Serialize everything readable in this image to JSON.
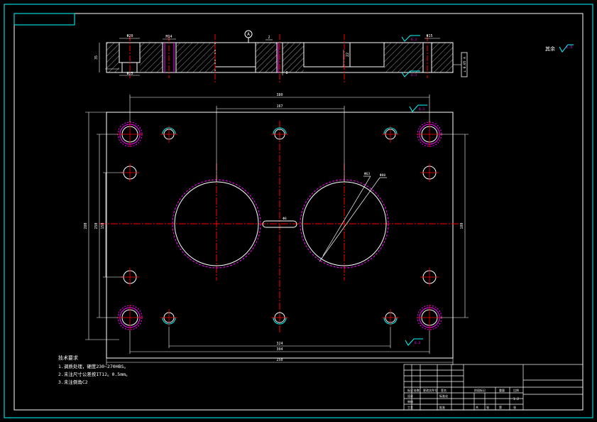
{
  "colors": {
    "background": "#000000",
    "border": "#00ffff",
    "outline": "#ffffff",
    "centerline": "#ff0000",
    "dimension": "#ffffff",
    "magenta": "#ff00ff",
    "finish": "#00ffff",
    "hatch": "#ffffff",
    "text": "#ffffff"
  },
  "section_view": {
    "label_A": "A",
    "dim_left_hole": "Φ20",
    "dim_left_counterbore": "Φ25",
    "dim_thread": "M14",
    "dim_height": "35",
    "dim_inner": "22",
    "dim_depth": "8",
    "dim_right_hole": "Φ15",
    "dim_right_small": "2",
    "tolerance_frame": "⊥ 0.05 A",
    "roughness_1": "6.3",
    "roughness_2": "6.3"
  },
  "plan_view": {
    "dim_overall_width": "380",
    "dim_top_inner": "167",
    "dim_bottom_1": "324",
    "dim_bottom_2": "304",
    "dim_bottom_3": "250",
    "dim_left_1": "280",
    "dim_left_2": "250",
    "dim_left_3": "158",
    "dim_right": "180",
    "dim_circle_1": "Φ63",
    "dim_circle_2": "Φ80",
    "dim_slot": "Φ8",
    "roughness_top": "6.3",
    "roughness_bottom": "6.3"
  },
  "roughness_note": {
    "label": "其余",
    "value": "6.3"
  },
  "notes": {
    "title": "技术要求",
    "line1": "1.调质处理，硬度230~270HBS。",
    "line2": "2.未注尺寸公差按IT12。0.5mm。",
    "line3": "3.未注倒角C2"
  },
  "title_block": {
    "c1": "标记",
    "c2": "处数",
    "c3": "更改文件号",
    "c4": "签名",
    "c5": "设计",
    "c6": "审核",
    "c7": "工艺",
    "c8": "标准化",
    "c9": "批准",
    "c10": "阶段标记",
    "c11": "重量",
    "c12": "比例",
    "scale": "1:2",
    "sheet1": "共",
    "sheet2": "张",
    "sheet3": "第",
    "sheet4": "张"
  }
}
